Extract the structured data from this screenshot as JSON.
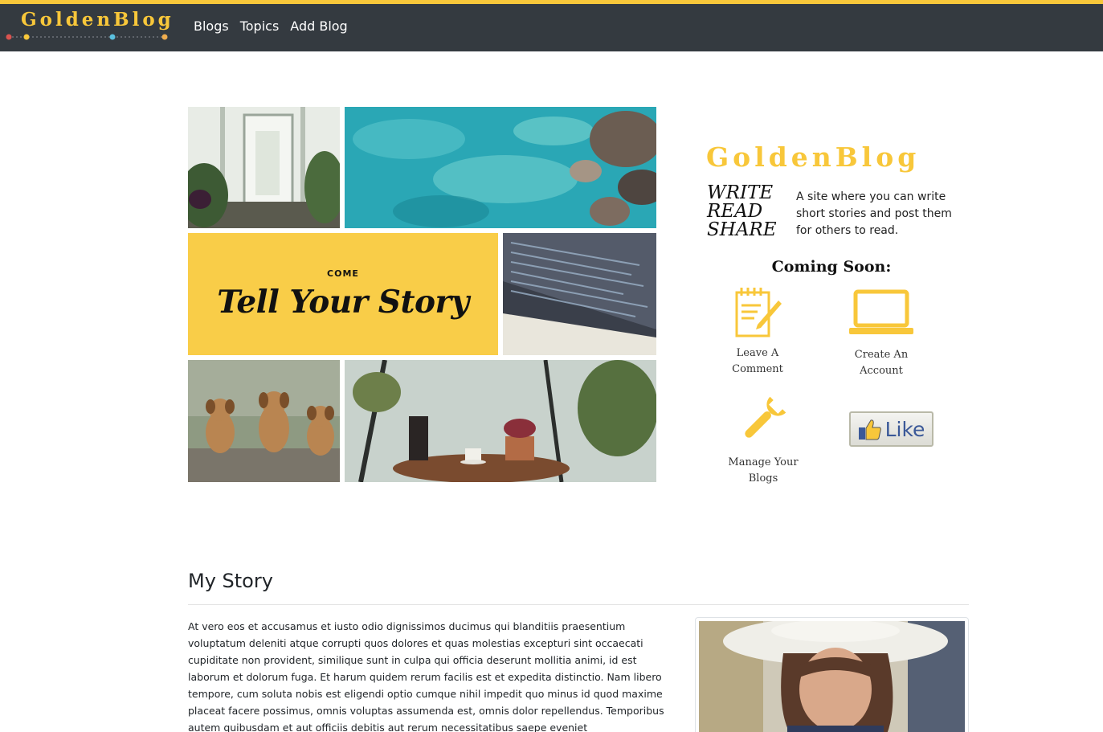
{
  "colors": {
    "accent": "#f8c73a",
    "navbar_bg": "#343a40",
    "story_tile_bg": "#f9cd48",
    "like_text": "#3b5998"
  },
  "navbar": {
    "brand": "GoldenBlog",
    "links": [
      "Blogs",
      "Topics",
      "Add Blog"
    ]
  },
  "hero": {
    "story_tile": {
      "small": "COME",
      "big": "Tell Your Story"
    },
    "photos": [
      "greenhouse-photo",
      "ocean-rocks-photo",
      "code-screen-photo",
      "puppies-photo",
      "cafe-table-photo"
    ]
  },
  "info": {
    "brand": "GoldenBlog",
    "motto": [
      "WRITE",
      "READ",
      "SHARE"
    ],
    "tagline": "A site where you can write short stories and post them for others to read.",
    "coming_soon": "Coming Soon:",
    "features": [
      {
        "icon": "notepad-pencil-icon",
        "label": "Leave A Comment"
      },
      {
        "icon": "laptop-icon",
        "label": "Create An Account"
      },
      {
        "icon": "wrench-icon",
        "label": "Manage Your Blogs"
      }
    ],
    "like_label": "Like"
  },
  "story": {
    "title": "My Story",
    "body": "At vero eos et accusamus et iusto odio dignissimos ducimus qui blanditiis praesentium voluptatum deleniti atque corrupti quos dolores et quas molestias excepturi sint occaecati cupiditate non provident, similique sunt in culpa qui officia deserunt mollitia animi, id est laborum et dolorum fuga. Et harum quidem rerum facilis est et expedita distinctio. Nam libero tempore, cum soluta nobis est eligendi optio cumque nihil impedit quo minus id quod maxime placeat facere possimus, omnis voluptas assumenda est, omnis dolor repellendus. Temporibus autem quibusdam et aut officiis debitis aut rerum necessitatibus saepe eveniet"
  }
}
